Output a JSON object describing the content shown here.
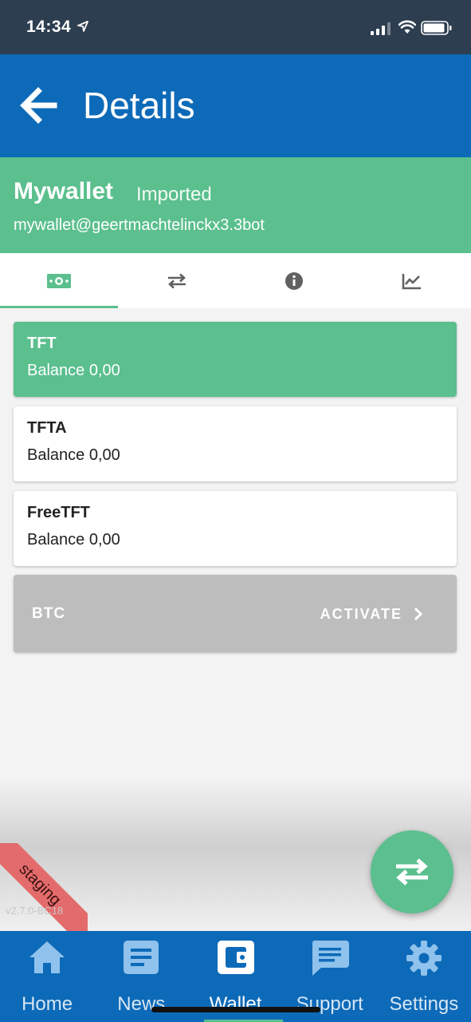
{
  "status_bar": {
    "time": "14:34"
  },
  "app_bar": {
    "title": "Details"
  },
  "wallet": {
    "name": "Mywallet",
    "status": "Imported",
    "address": "mywallet@geertmachtelinckx3.3bot"
  },
  "tabs": [
    {
      "icon": "money-icon",
      "active": true
    },
    {
      "icon": "transfer-icon",
      "active": false
    },
    {
      "icon": "info-icon",
      "active": false
    },
    {
      "icon": "chart-icon",
      "active": false
    }
  ],
  "assets": [
    {
      "name": "TFT",
      "balance": "Balance 0,00",
      "selected": true
    },
    {
      "name": "TFTA",
      "balance": "Balance 0,00",
      "selected": false
    },
    {
      "name": "FreeTFT",
      "balance": "Balance 0,00",
      "selected": false
    }
  ],
  "btc": {
    "name": "BTC",
    "action": "ACTIVATE"
  },
  "ribbon": {
    "label": "staging"
  },
  "version": "v2.7.0-BC18",
  "bottom_nav": [
    {
      "label": "Home",
      "icon": "home-icon"
    },
    {
      "label": "News",
      "icon": "news-icon"
    },
    {
      "label": "Wallet",
      "icon": "wallet-icon",
      "active": true
    },
    {
      "label": "Support",
      "icon": "chat-icon"
    },
    {
      "label": "Settings",
      "icon": "gear-icon"
    }
  ],
  "colors": {
    "primary": "#0d6ab8",
    "accent": "#5bbf8e",
    "disabled": "#bdbdbd",
    "ribbon": "#e46b6b"
  }
}
